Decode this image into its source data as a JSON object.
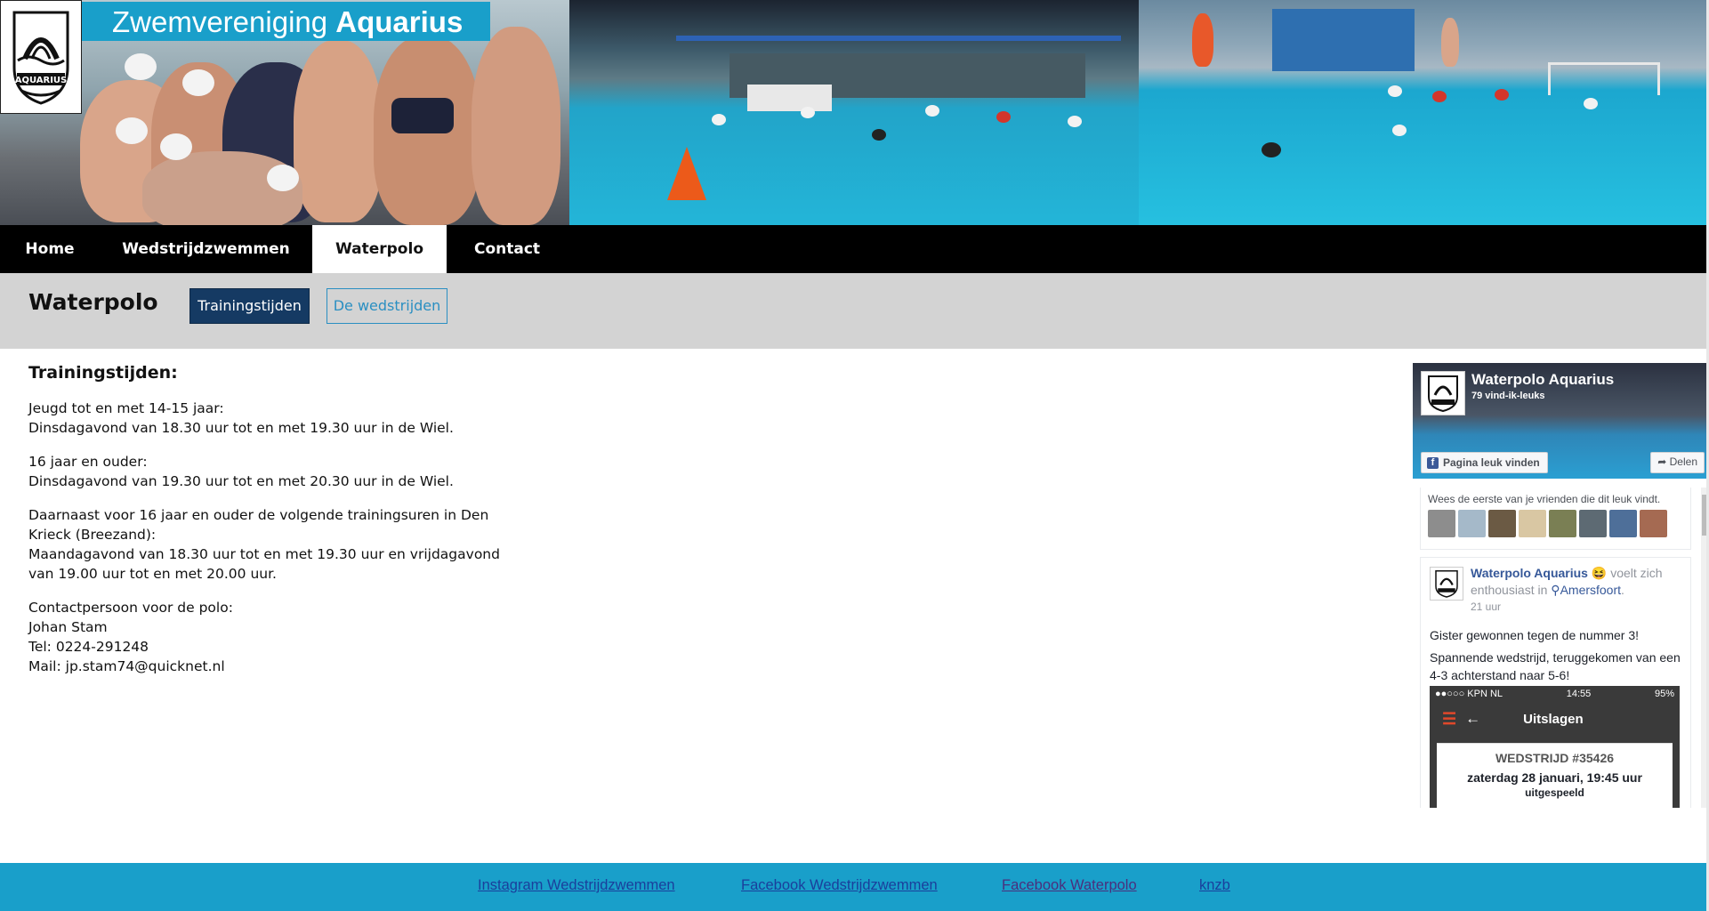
{
  "site": {
    "title_regular": "Zwemvereniging",
    "title_bold": "Aquarius",
    "logo_text": "AQUARIUS"
  },
  "nav": {
    "items": [
      {
        "label": "Home"
      },
      {
        "label": "Wedstrijdzwemmen"
      },
      {
        "label": "Waterpolo"
      },
      {
        "label": "Contact"
      }
    ],
    "active": "Waterpolo"
  },
  "subnav": {
    "page_title": "Waterpolo",
    "buttons": [
      {
        "label": "Trainingstijden",
        "active": true
      },
      {
        "label": "De wedstrijden",
        "active": false
      }
    ]
  },
  "content": {
    "heading": "Trainingstijden:",
    "paragraphs": [
      {
        "line1": "Jeugd tot en met 14-15 jaar:",
        "line2": "Dinsdagavond van 18.30 uur tot en met 19.30 uur in de Wiel."
      },
      {
        "line1": "16 jaar en ouder:",
        "line2": "Dinsdagavond van 19.30 uur tot en met 20.30 uur in de Wiel."
      },
      {
        "line1": "Daarnaast voor 16 jaar en ouder de volgende trainingsuren in Den Krieck (Breezand):",
        "line2": "Maandagavond van 18.30 uur tot en met 19.30 uur en vrijdagavond van 19.00 uur tot en met 20.00 uur."
      }
    ],
    "contact": {
      "label": "Contactpersoon voor de polo:",
      "name": "Johan Stam",
      "tel": "Tel: 0224-291248",
      "mail": "Mail: jp.stam74@quicknet.nl"
    }
  },
  "facebook": {
    "page_name": "Waterpolo Aquarius",
    "likes": "79 vind-ik-leuks",
    "like_button": "Pagina leuk vinden",
    "share_button": "Delen",
    "friends_text": "Wees de eerste van je vrienden die dit leuk vindt.",
    "post": {
      "author": "Waterpolo Aquarius",
      "emoji": "😆",
      "feeling": "voelt zich enthousiast in",
      "location": "Amersfoort",
      "time": "21 uur",
      "text1": "Gister gewonnen tegen de nummer 3!",
      "text2": "Spannende wedstrijd, teruggekomen van een 4-3 achterstand naar 5-6!",
      "phone": {
        "carrier": "●●○○○ KPN NL",
        "clock": "14:55",
        "battery": "95%",
        "bar_title": "Uitslagen",
        "match_title": "WEDSTRIJD #35426",
        "match_date": "zaterdag 28 januari, 19:45 uur",
        "match_status": "uitgespeeld"
      }
    }
  },
  "footer": {
    "links": [
      {
        "label": "Instagram Wedstrijdzwemmen"
      },
      {
        "label": "Facebook Wedstrijdzwemmen"
      },
      {
        "label": "Facebook Waterpolo"
      },
      {
        "label": "knzb"
      }
    ]
  },
  "colors": {
    "brand_blue": "#199fca",
    "nav_bg": "#000000",
    "subnav_bg": "#d3d3d3",
    "active_button": "#153a63",
    "outline_button": "#2a8fc2"
  }
}
